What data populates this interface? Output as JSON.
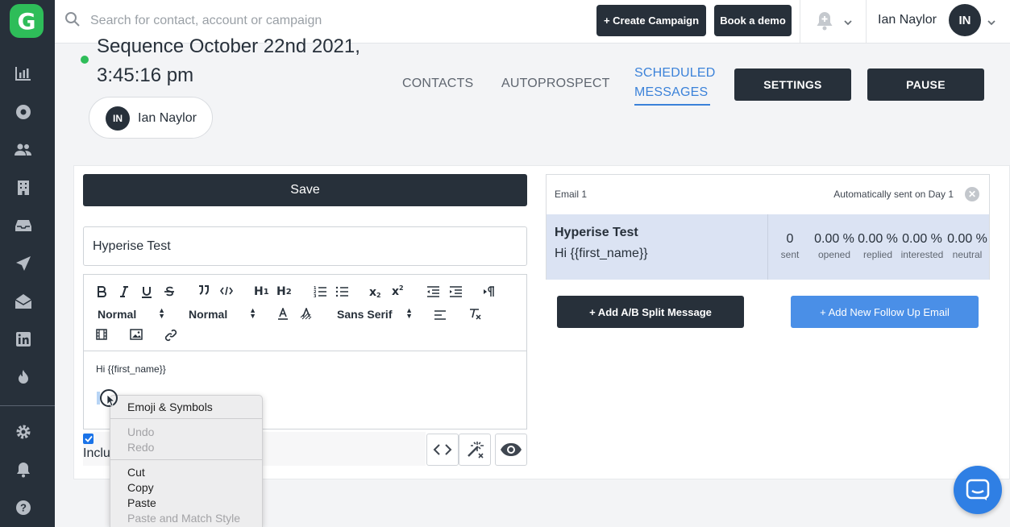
{
  "search": {
    "placeholder": "Search for contact, account or campaign"
  },
  "topbar": {
    "create_campaign": "+ Create Campaign",
    "book_demo": "Book a demo",
    "user_name": "Ian Naylor",
    "user_initials": "IN"
  },
  "sequence": {
    "title": "Sequence October 22nd 2021, 3:45:16 pm",
    "owner_name": "Ian Naylor",
    "owner_initials": "IN"
  },
  "tabs": [
    {
      "label": "CONTACTS"
    },
    {
      "label": "AUTOPROSPECT"
    },
    {
      "label": "SCHEDULED MESSAGES"
    }
  ],
  "header_buttons": {
    "settings": "SETTINGS",
    "pause": "PAUSE"
  },
  "editor": {
    "save_label": "Save",
    "subject_value": "Hyperise Test",
    "header_select": "Normal",
    "size_select": "Normal",
    "font_select": "Sans Serif",
    "body_line1": "Hi {{first_name}}",
    "include_label": "Inclu"
  },
  "email_card": {
    "label": "Email 1",
    "schedule": "Automatically sent on Day 1",
    "name": "Hyperise Test",
    "preview": "Hi {{first_name}}",
    "stats": [
      {
        "value": "0",
        "label": "sent"
      },
      {
        "value": "0.00 %",
        "label": "opened"
      },
      {
        "value": "0.00 %",
        "label": "replied"
      },
      {
        "value": "0.00 %",
        "label": "interested"
      },
      {
        "value": "0.00 %",
        "label": "neutral"
      }
    ]
  },
  "actions": {
    "ab_split": "+ Add A/B Split Message",
    "follow_up": "+ Add New Follow Up Email"
  },
  "context_menu": {
    "emoji": "Emoji & Symbols",
    "undo": "Undo",
    "redo": "Redo",
    "cut": "Cut",
    "copy": "Copy",
    "paste": "Paste",
    "paste_match": "Paste and Match Style"
  },
  "colors": {
    "brand_green": "#2ebd59",
    "dark": "#27303a",
    "accent_blue": "#3b82d9"
  }
}
